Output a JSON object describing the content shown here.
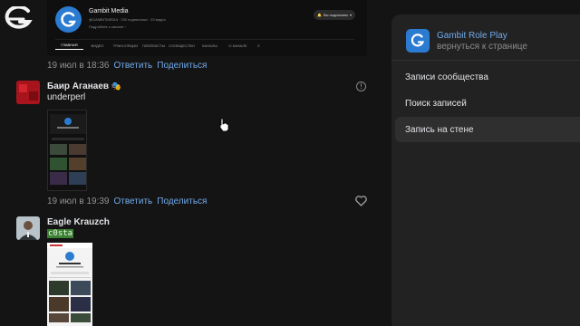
{
  "channel": {
    "name": "Gambit Media",
    "meta": "@GAMBITMEDIA · 232 подписчика · 23 видео",
    "more": "Подробнее о канале  ›",
    "subscribed_label": "Вы подписаны",
    "tabs": [
      "Главная",
      "Видео",
      "Трансляции",
      "Плейлисты",
      "Сообщество",
      "Каналы",
      "О канале"
    ]
  },
  "post1": {
    "date": "19 июл в 18:36",
    "reply": "Ответить",
    "share": "Поделиться"
  },
  "comment1": {
    "author": "Баир Аганаев",
    "text": "underperl",
    "date": "19 июл в 19:39",
    "reply": "Ответить",
    "share": "Поделиться"
  },
  "comment2": {
    "author": "Eagle Krauzch",
    "text": "c0sta"
  },
  "panel": {
    "group_name": "Gambit Role Play",
    "back_label": "вернуться к странице",
    "menu": [
      {
        "label": "Записи сообщества"
      },
      {
        "label": "Поиск записей"
      },
      {
        "label": "Запись на стене"
      }
    ]
  }
}
